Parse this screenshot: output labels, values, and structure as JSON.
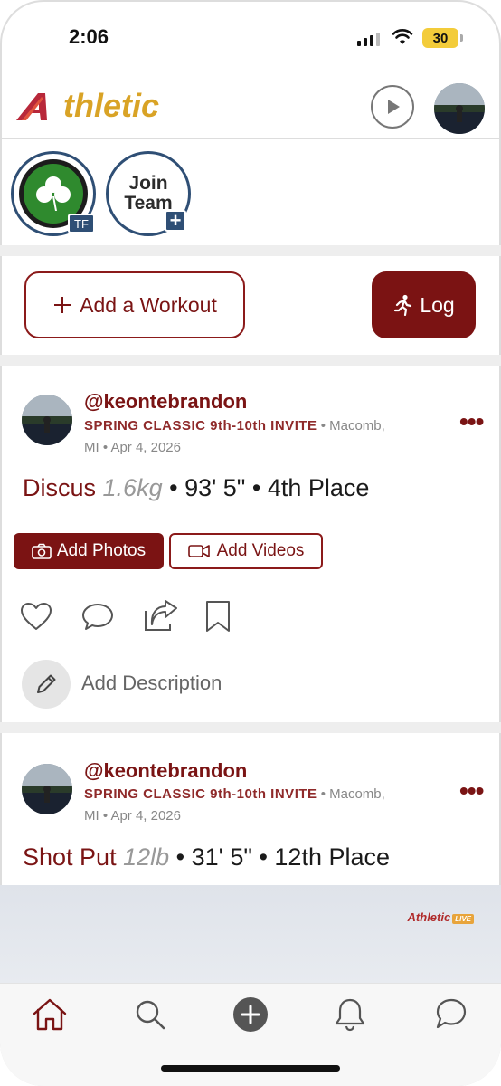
{
  "status_bar": {
    "time": "2:06",
    "battery": "30"
  },
  "header": {
    "logo_text": "thletic",
    "play_icon": "play-circle-icon"
  },
  "teams": [
    {
      "badge": "TF",
      "logo": "shamrock-icon"
    },
    {
      "label_line1": "Join",
      "label_line2": "Team",
      "badge": "+"
    }
  ],
  "actions": {
    "add_workout": "Add a Workout",
    "log": "Log"
  },
  "posts": [
    {
      "username": "@keontebrandon",
      "meet": "SPRING CLASSIC 9th-10th INVITE",
      "location_part1": "Macomb,",
      "location_part2": "MI",
      "date": "Apr 4, 2026",
      "event": "Discus",
      "weight": "1.6kg",
      "mark": "93' 5\"",
      "place": "4th Place",
      "add_photos": "Add Photos",
      "add_videos": "Add Videos",
      "add_description": "Add Description"
    },
    {
      "username": "@keontebrandon",
      "meet": "SPRING CLASSIC 9th-10th INVITE",
      "location_part1": "Macomb,",
      "location_part2": "MI",
      "date": "Apr 4, 2026",
      "event": "Shot Put",
      "weight": "12lb",
      "mark": "31' 5\"",
      "place": "12th Place"
    }
  ],
  "preview": {
    "logo_text": "thletic",
    "logo_initial": "A",
    "live": "LIVE"
  },
  "tabbar": {
    "items": [
      "home-icon",
      "search-icon",
      "add-circle-icon",
      "bell-icon",
      "chat-icon"
    ]
  },
  "colors": {
    "brand": "#7b1313",
    "gold": "#d9a326",
    "team_blue": "#2f4f75"
  }
}
